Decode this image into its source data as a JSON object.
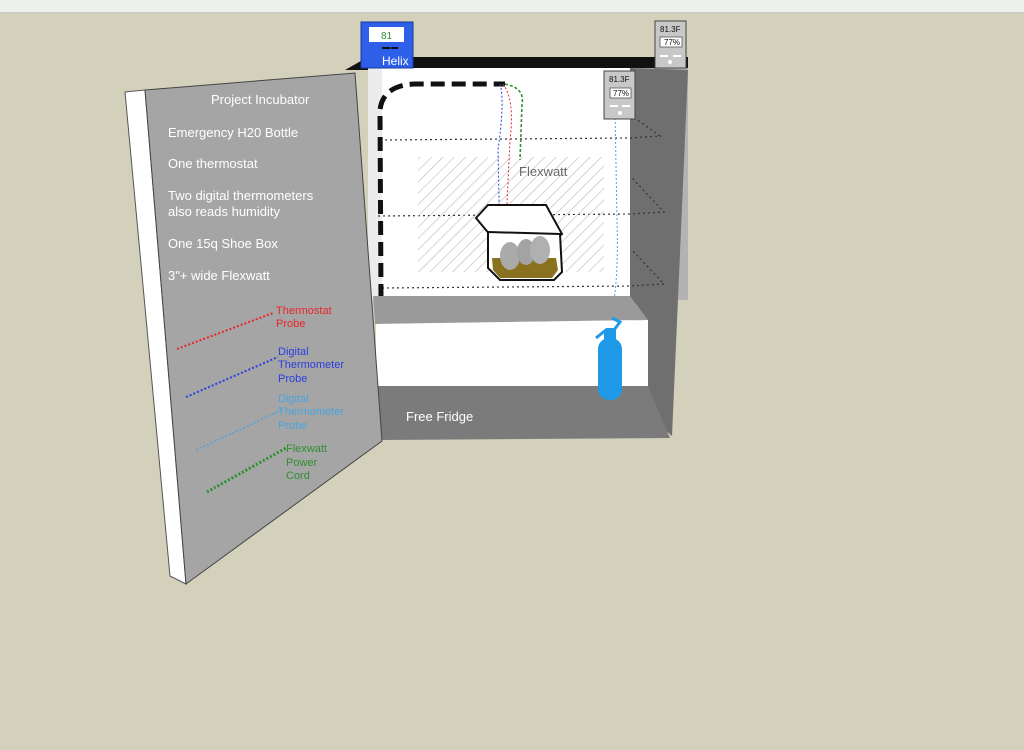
{
  "title": "Project Incubator",
  "features": [
    "Emergency H20 Bottle",
    "One thermostat",
    "Two digital thermometers",
    "also reads humidity",
    "One 15q Shoe Box",
    "3\"+ wide Flexwatt"
  ],
  "legend": [
    {
      "line1": "Thermostat",
      "line2": "Probe",
      "line3": "",
      "color": "#e8262a"
    },
    {
      "line1": "Digital",
      "line2": "Thermometer",
      "line3": "Probe",
      "color": "#2b3ee0"
    },
    {
      "line1": "Digital",
      "line2": "Thermometer",
      "line3": "Probe",
      "color": "#4aa3e0"
    },
    {
      "line1": "Flexwatt",
      "line2": "Power",
      "line3": "Cord",
      "color": "#2f8f2f"
    }
  ],
  "thermostat": {
    "reading": "81",
    "brand": "Helix",
    "color": "#2e5fe8"
  },
  "top_thermometer": {
    "temp": "81.3F",
    "humidity": "77%"
  },
  "inner_thermometer": {
    "temp": "81.3F",
    "humidity": "77%"
  },
  "flexwatt_label": "Flexwatt",
  "fridge_label": "Free Fridge",
  "colors": {
    "background": "#d3d1bb",
    "water_bottle": "#1e9ae8"
  }
}
